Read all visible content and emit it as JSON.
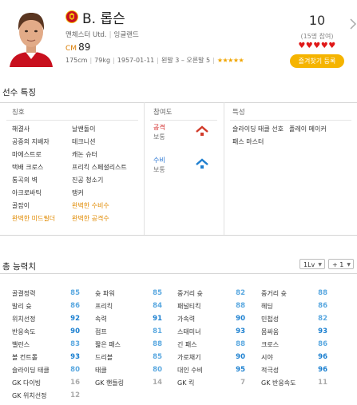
{
  "player": {
    "name": "B. 롭슨",
    "club": "맨체스터 Utd.",
    "nation": "잉글랜드",
    "position": "CM",
    "ovr": "89",
    "height": "175cm",
    "weight": "79kg",
    "birth": "1957-01-11",
    "foot": "왼발 3 – 오른발 5",
    "skill_stars": "★★★★★",
    "rating": "10",
    "rating_count": "(15명 참여)",
    "hearts": "♥♥♥♥♥",
    "favorite_label": "즐겨찾기 등록"
  },
  "traits_section": {
    "title": "선수 특징",
    "header_nick": "칭호",
    "header_part": "참여도",
    "header_feat": "특성",
    "nicknames": [
      [
        "해결사",
        "날쌘돌이"
      ],
      [
        "공중의 지배자",
        "테크니션"
      ],
      [
        "마에스트로",
        "캐논 슈터"
      ],
      [
        "택배 크로스",
        "프리킥 스페셜리스트"
      ],
      [
        "통곡의 벽",
        "진공 청소기"
      ],
      [
        "아크로바틱",
        "탱커"
      ],
      [
        "골잡이",
        "완벽한 수비수"
      ],
      [
        "완벽한 미드필더",
        "완벽한 공격수"
      ]
    ],
    "attack_label": "공격",
    "attack_value": "보통",
    "defense_label": "수비",
    "defense_value": "보통",
    "features": [
      "슬라이딩 태클 선호",
      "플레이 메이커",
      "패스 마스터"
    ]
  },
  "abilities_section": {
    "title": "총 능력치",
    "level_select": "1Lv",
    "plus_select": "+ 1",
    "rows": [
      [
        [
          "골결정력",
          "85"
        ],
        [
          "슛 파워",
          "85"
        ],
        [
          "중거리 슛",
          "82"
        ],
        [
          "중거리 슛",
          "88"
        ]
      ],
      [
        [
          "발리 슛",
          "86"
        ],
        [
          "프리킥",
          "84"
        ],
        [
          "패널티킥",
          "88"
        ],
        [
          "헤딩",
          "86"
        ]
      ],
      [
        [
          "위치선정",
          "92"
        ],
        [
          "속력",
          "91"
        ],
        [
          "가속력",
          "90"
        ],
        [
          "민첩성",
          "82"
        ]
      ],
      [
        [
          "반응속도",
          "90"
        ],
        [
          "점프",
          "81"
        ],
        [
          "스태미너",
          "93"
        ],
        [
          "몸싸움",
          "93"
        ]
      ],
      [
        [
          "밸런스",
          "83"
        ],
        [
          "짧은 패스",
          "88"
        ],
        [
          "긴 패스",
          "88"
        ],
        [
          "크로스",
          "86"
        ]
      ],
      [
        [
          "볼 컨트롤",
          "93"
        ],
        [
          "드리블",
          "85"
        ],
        [
          "가로채기",
          "90"
        ],
        [
          "시야",
          "96"
        ]
      ],
      [
        [
          "슬라이딩 태클",
          "80"
        ],
        [
          "태클",
          "80"
        ],
        [
          "대인 수비",
          "95"
        ],
        [
          "적극성",
          "96"
        ]
      ],
      [
        [
          "GK 다이빙",
          "16"
        ],
        [
          "GK 핸들링",
          "14"
        ],
        [
          "GK 킥",
          "7"
        ],
        [
          "GK 반응속도",
          "11"
        ]
      ],
      [
        [
          "GK 위치선정",
          "12"
        ],
        [
          "",
          ""
        ],
        [
          "",
          ""
        ],
        [
          "",
          ""
        ]
      ]
    ]
  }
}
